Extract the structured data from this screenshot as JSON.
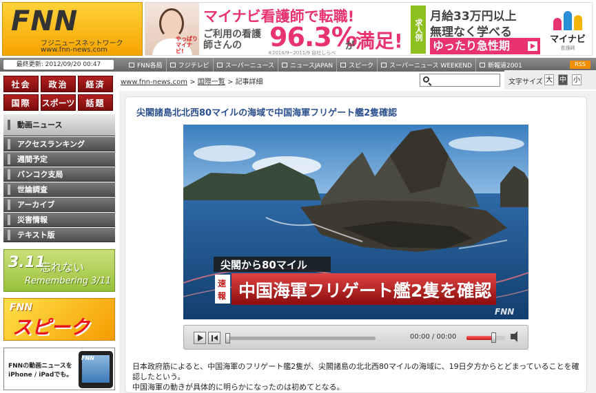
{
  "header": {
    "logo": "FNN",
    "logo_sub": "フジニュースネットワーク",
    "logo_url": "www.fnn-news.com",
    "ad": {
      "photo_tag": "やっぱりマイナビ!",
      "line1": "マイナビ看護師で転職!",
      "line2": "ご利用の看護師さんの",
      "percent": "96.3%",
      "ga": "が",
      "manzoku": "満足!",
      "note": "※2010/9~2011/9 自社しらべ",
      "green_label": "求人例",
      "r1": "月給33万円以上",
      "r2": "無理なく学べる",
      "r3": "ゆったり急性期",
      "brand": "マイナビ",
      "brand_sub": "看護師",
      "brand_colors": [
        "#e8336e",
        "#2a8fd6",
        "#f6b400"
      ]
    }
  },
  "navbar": {
    "updated": "最終更新: 2012/09/20 00:47",
    "links": [
      "FNN各局",
      "フジテレビ",
      "スーパーニュース",
      "ニュースJAPAN",
      "スピーク",
      "スーパーニュース WEEKEND",
      "新報道2001"
    ],
    "rss": "RSS"
  },
  "sidebar": {
    "categories": [
      "社会",
      "政治",
      "経済",
      "国際",
      "スポーツ",
      "話題"
    ],
    "menu": [
      "動画ニュース",
      "アクセスランキング",
      "週間予定",
      "バンコク支局",
      "世論調査",
      "アーカイブ",
      "災害情報",
      "テキスト版"
    ],
    "banner311": {
      "b1": "3.11",
      "b2": "忘れない",
      "b3": "Remembering 3/11"
    },
    "banner_speak": {
      "s1": "FNN",
      "s2": "スピーク"
    },
    "banner_iphone": {
      "line1": "FNNの動画ニュースを",
      "line2": "iPhone / iPadでも。",
      "phone_logo": "FNN"
    }
  },
  "breadcrumb": {
    "home": "www.fnn-news.com",
    "sep1": ">",
    "section": "国際一覧",
    "sep2": ">",
    "current": "記事詳細"
  },
  "tools": {
    "search_placeholder": "",
    "fontsize_label": "文字サイズ",
    "sizes": [
      "大",
      "中",
      "小"
    ],
    "active_size": "中"
  },
  "article": {
    "title": "尖閣諸島北北西80マイルの海域で中国海軍フリゲート艦2隻確認",
    "video": {
      "caption_small": "尖閣から80マイル",
      "badge": "速報",
      "caption_big": "中国海軍フリゲート艦2隻を確認",
      "watermark": "FNN"
    },
    "player": {
      "time": "00:00 / 00:00",
      "progress": 0,
      "volume": 0.7
    },
    "body": [
      "日本政府筋によると、中国海軍のフリゲート艦2隻が、尖閣諸島の北北西80マイルの海域に、19日夕方からとどまっていることを確認したという。",
      "中国海軍の動きが具体的に明らかになったのは初めてとなる。"
    ]
  },
  "colors": {
    "category_red": "#9b1616",
    "title_blue": "#2b4f8e",
    "rss_orange": "#f18d00"
  }
}
